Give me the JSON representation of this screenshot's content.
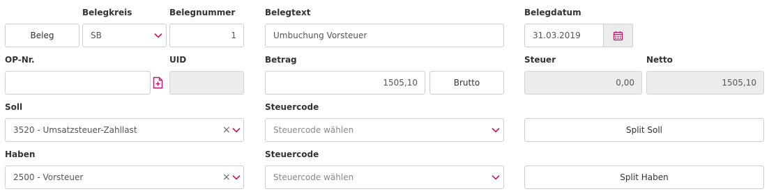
{
  "labels": {
    "belegkreis": "Belegkreis",
    "belegnummer": "Belegnummer",
    "belegtext": "Belegtext",
    "belegdatum": "Belegdatum",
    "op_nr": "OP-Nr.",
    "uid": "UID",
    "betrag": "Betrag",
    "steuer": "Steuer",
    "netto": "Netto",
    "soll": "Soll",
    "steuercode_soll": "Steuercode",
    "haben": "Haben",
    "steuercode_haben": "Steuercode"
  },
  "fields": {
    "beleg_button": "Beleg",
    "belegkreis_value": "SB",
    "belegnummer_value": "1",
    "belegtext_value": "Umbuchung Vorsteuer",
    "belegdatum_value": "31.03.2019",
    "op_nr_value": "",
    "uid_value": "",
    "betrag_value": "1505,10",
    "brutto_button": "Brutto",
    "steuer_value": "0,00",
    "netto_value": "1505,10",
    "soll_value": "3520 - Umsatzsteuer-Zahllast",
    "steuercode_soll_placeholder": "Steuercode wählen",
    "split_soll_button": "Split Soll",
    "haben_value": "2500 - Vorsteuer",
    "steuercode_haben_placeholder": "Steuercode wählen",
    "split_haben_button": "Split Haben"
  },
  "icons": {
    "chevron": "chevron-down-icon",
    "clear": "clear-icon",
    "calendar": "calendar-icon",
    "add_document": "add-document-icon"
  },
  "colors": {
    "accent": "#c0156d",
    "border": "#cfcfcf",
    "disabled_bg": "#ececec"
  }
}
